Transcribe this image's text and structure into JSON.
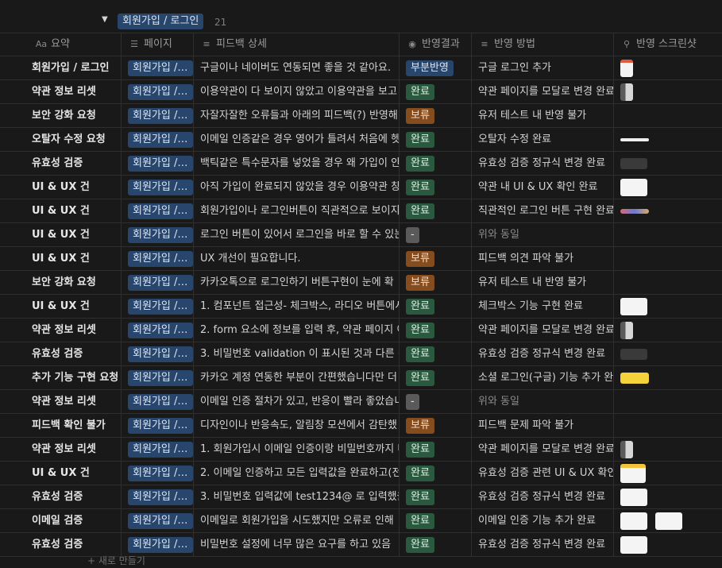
{
  "group": {
    "label": "회원가입 / 로그인",
    "count": "21"
  },
  "columns": [
    {
      "icon": "Aa",
      "icon_name": "title-property-icon",
      "label": "요약"
    },
    {
      "icon": "☰",
      "icon_name": "list-property-icon",
      "label": "페이지"
    },
    {
      "icon": "≡",
      "icon_name": "text-property-icon",
      "label": "피드백 상세"
    },
    {
      "icon": "◉",
      "icon_name": "select-property-icon",
      "label": "반영결과"
    },
    {
      "icon": "≡",
      "icon_name": "text-property-icon",
      "label": "반영 방법"
    },
    {
      "icon": "⚲",
      "icon_name": "paperclip-icon",
      "label": "반영 스크린샷"
    }
  ],
  "rows": [
    {
      "summary": "회원가입 / 로그인",
      "page": "회원가입 / 로그인",
      "detail": "구글이나 네이버도 연동되면 좋을 것 같아요.",
      "status": "부분반영",
      "status_color": "blue",
      "method": "구글 로그인 추가",
      "shots": [
        "red"
      ]
    },
    {
      "summary": "약관 정보 리셋",
      "page": "회원가입 / 로그인",
      "detail": "이용약관이 다 보이지 않았고 이용약관을 보고",
      "status": "완료",
      "status_color": "green",
      "method": "약관 페이지를 모달로 변경 완료",
      "shots": [
        "gray"
      ]
    },
    {
      "summary": "보안 강화 요청",
      "page": "회원가입 / 로그인",
      "detail": "자잘자잘한 오류들과 아래의 피드백(?) 반영해",
      "status": "보류",
      "status_color": "orange",
      "method": "유저 테스트 내 반영 불가",
      "shots": []
    },
    {
      "summary": "오탈자 수정 요청",
      "page": "회원가입 / 로그인",
      "detail": "이메일 인증같은 경우 영어가 틀려서 처음에 헷",
      "status": "완료",
      "status_color": "green",
      "method": "오탈자 수정 완료",
      "shots": [
        "line"
      ]
    },
    {
      "summary": "유효성 검증",
      "page": "회원가입 / 로그인",
      "detail": "백틱같은 특수문자를 넣었을 경우 왜 가입이 안",
      "status": "완료",
      "status_color": "green",
      "method": "유효성 검증 정규식 변경 완료",
      "shots": [
        "dark"
      ]
    },
    {
      "summary": "UI & UX 건",
      "page": "회원가입 / 로그인",
      "detail": "아직 가입이 완료되지 않았을 경우 이용약관 창",
      "status": "완료",
      "status_color": "green",
      "method": "약관 내 UI & UX 확인 완료",
      "shots": [
        "white"
      ]
    },
    {
      "summary": "UI & UX 건",
      "page": "회원가입 / 로그인",
      "detail": "회원가입이나 로그인버튼이 직관적으로 보이지",
      "status": "완료",
      "status_color": "green",
      "method": "직관적인 로그인 버튼 구현 완료",
      "shots": [
        "strip"
      ]
    },
    {
      "summary": "UI & UX 건",
      "page": "회원가입 / 로그인",
      "detail": "로그인 버튼이 있어서 로그인을 바로 할 수 있는",
      "status": "-",
      "status_color": "gray",
      "method": "위와 동일",
      "method_muted": true,
      "shots": []
    },
    {
      "summary": "UI & UX 건",
      "page": "회원가입 / 로그인",
      "detail": "UX 개선이 필요합니다.",
      "status": "보류",
      "status_color": "orange",
      "method": "피드백 의견 파악 불가",
      "shots": []
    },
    {
      "summary": "보안 강화 요청",
      "page": "회원가입 / 로그인",
      "detail": "카카오톡으로 로그인하기 버튼구현이 눈에 확",
      "status": "보류",
      "status_color": "orange",
      "method": "유저 테스트 내 반영 불가",
      "shots": []
    },
    {
      "summary": "UI & UX 건",
      "page": "회원가입 / 로그인",
      "detail": "1. 컴포넌트 접근성- 체크박스, 라디오 버튼에서",
      "status": "완료",
      "status_color": "green",
      "method": "체크박스 기능 구현 완료",
      "shots": [
        "white"
      ]
    },
    {
      "summary": "약관 정보 리셋",
      "page": "회원가입 / 로그인",
      "detail": "2. form 요소에 정보를 입력 후, 약관 페이지 이",
      "status": "완료",
      "status_color": "green",
      "method": "약관 페이지를 모달로 변경 완료",
      "shots": [
        "gray"
      ]
    },
    {
      "summary": "유효성 검증",
      "page": "회원가입 / 로그인",
      "detail": "3. 비밀번호 validation 이 표시된 것과 다른 것",
      "status": "완료",
      "status_color": "green",
      "method": "유효성 검증 정규식 변경 완료",
      "shots": [
        "dark"
      ]
    },
    {
      "summary": "추가 기능 구현 요청",
      "page": "회원가입 / 로그인",
      "detail": "카카오 계정 연동한 부분이 간편했습니다만 더",
      "status": "완료",
      "status_color": "green",
      "method": "소셜 로그인(구글) 기능 추가 완료",
      "shots": [
        "yellow"
      ]
    },
    {
      "summary": "약관 정보 리셋",
      "page": "회원가입 / 로그인",
      "detail": "이메일 인증 절차가 있고, 반응이 빨라 좋았습니다",
      "status": "-",
      "status_color": "gray",
      "method": "위와 동일",
      "method_muted": true,
      "shots": []
    },
    {
      "summary": "피드백 확인 불가",
      "page": "회원가입 / 로그인",
      "detail": "디자인이나 반응속도, 알림창 모션에서 감탄했",
      "status": "보류",
      "status_color": "orange",
      "method": "피드백 문제 파악 불가",
      "shots": []
    },
    {
      "summary": "약관 정보 리셋",
      "page": "회원가입 / 로그인",
      "detail": "1. 회원가입시 이메일 인증이랑 비밀번호까지 다",
      "status": "완료",
      "status_color": "green",
      "method": "약관 페이지를 모달로 변경 완료",
      "shots": [
        "gray"
      ]
    },
    {
      "summary": "UI & UX 건",
      "page": "회원가입 / 로그인",
      "detail": "2. 이메일 인증하고 모든 입력값을 완료하고(전",
      "status": "완료",
      "status_color": "green",
      "method": "유효성 검증 관련 UI & UX 확인 완료",
      "shots": [
        "ywhite"
      ]
    },
    {
      "summary": "유효성 검증",
      "page": "회원가입 / 로그인",
      "detail": "3. 비밀번호 입력값에 test1234@ 로 입력했을 때",
      "status": "완료",
      "status_color": "green",
      "method": "유효성 검증 정규식 변경 완료",
      "shots": [
        "white"
      ]
    },
    {
      "summary": "이메일 검증",
      "page": "회원가입 / 로그인",
      "detail": "이메일로 회원가입을 시도했지만 오류로 인해",
      "status": "완료",
      "status_color": "green",
      "method": "이메일 인증 기능 추가 완료",
      "shots": [
        "white",
        "white"
      ]
    },
    {
      "summary": "유효성 검증",
      "page": "회원가입 / 로그인",
      "detail": "비밀번호 설정에 너무 많은 요구를 하고 있음",
      "status": "완료",
      "status_color": "green",
      "method": "유효성 검증 정규식 변경 완료",
      "shots": [
        "white"
      ]
    }
  ],
  "footer": {
    "label": "+ 새로 만들기"
  },
  "toggle_glyph": "▼"
}
